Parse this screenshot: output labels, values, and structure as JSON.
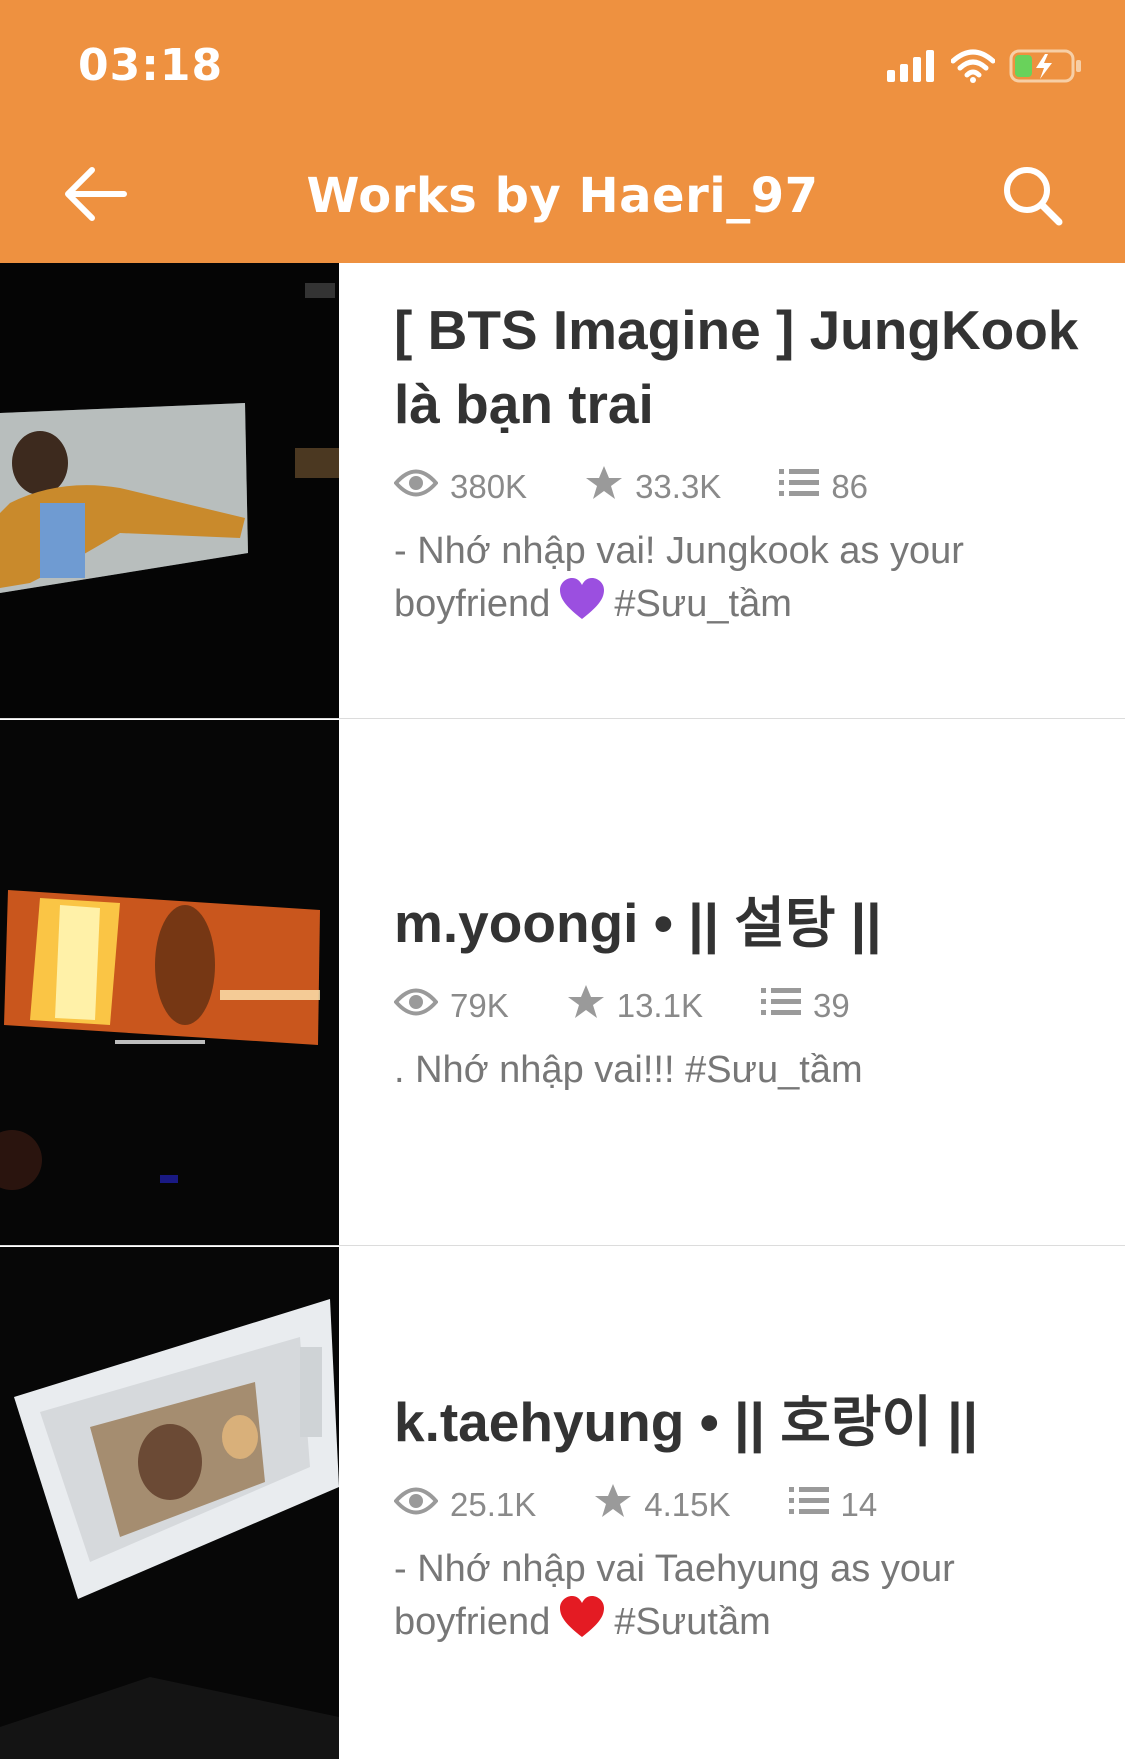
{
  "status_bar": {
    "time": "03:18",
    "icons": [
      "signal-icon",
      "wifi-icon",
      "battery-charging-icon"
    ]
  },
  "header": {
    "title": "Works by Haeri_97",
    "back_icon": "arrow-left-icon",
    "search_icon": "search-icon",
    "background_color": "#ee9140"
  },
  "stories": [
    {
      "title": "[ BTS Imagine ] JungKook là bạn trai",
      "reads": "380K",
      "votes": "33.3K",
      "parts": "86",
      "description_text": "- Nhớ nhập vai!  Jungkook as your boyfriend",
      "description_emoji": "purple-heart-icon",
      "description_tag": "#Sưu_tầm"
    },
    {
      "title": "m.yoongi • || 설탕 ||",
      "reads": "79K",
      "votes": "13.1K",
      "parts": "39",
      "description_text": ". Nhớ nhập vai!!! #Sưu_tầm"
    },
    {
      "title": "k.taehyung • || 호랑이 ||",
      "reads": "25.1K",
      "votes": "4.15K",
      "parts": "14",
      "description_text": "- Nhớ nhập vai Taehyung as your boyfriend",
      "description_emoji": "red-heart-icon",
      "description_tag": "#Sưutầm"
    }
  ]
}
